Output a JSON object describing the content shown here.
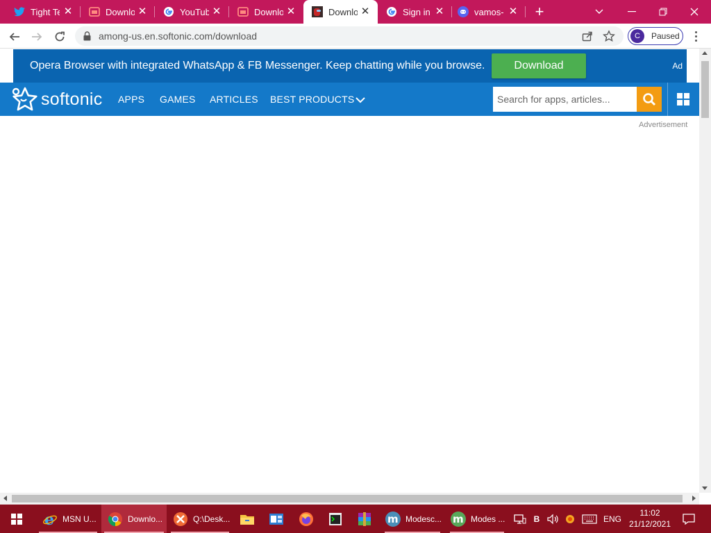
{
  "tabs": [
    {
      "title": "Tight Te",
      "icon": "twitter-icon",
      "active": false
    },
    {
      "title": "Downlo",
      "icon": "softonic-dl-icon",
      "active": false
    },
    {
      "title": "YouTub",
      "icon": "google-icon",
      "active": false
    },
    {
      "title": "Downlo",
      "icon": "softonic-dl-icon",
      "active": false
    },
    {
      "title": "Downlo",
      "icon": "among-us-icon",
      "active": true
    },
    {
      "title": "Sign in",
      "icon": "google-icon",
      "active": false
    },
    {
      "title": "vamos-",
      "icon": "discord-icon",
      "active": false
    }
  ],
  "tab_close_glyph": "✕",
  "new_tab_glyph": "+",
  "address": {
    "url": "among-us.en.softonic.com/download"
  },
  "profile": {
    "initial": "C",
    "status": "Paused"
  },
  "ad": {
    "message": "Opera Browser with integrated WhatsApp & FB Messenger. Keep chatting while you browse.",
    "button": "Download",
    "tag": "Ad"
  },
  "nav": {
    "brand": "softonic",
    "items": [
      "APPS",
      "GAMES",
      "ARTICLES",
      "BEST PRODUCTS"
    ],
    "search_placeholder": "Search for apps, articles..."
  },
  "advertisement_label": "Advertisement",
  "taskbar": {
    "apps": [
      {
        "label": "MSN U...",
        "icon": "internet-explorer-icon"
      },
      {
        "label": "Downlo...",
        "icon": "chrome-icon",
        "active": true
      },
      {
        "label": "Q:\\Desk...",
        "icon": "xampp-icon"
      },
      {
        "label": "",
        "icon": "file-explorer-icon"
      },
      {
        "label": "",
        "icon": "outlook-icon"
      },
      {
        "label": "",
        "icon": "firefox-icon"
      },
      {
        "label": "",
        "icon": "terminal-icon"
      },
      {
        "label": "",
        "icon": "winrar-icon"
      },
      {
        "label": "Modesc...",
        "icon": "modescore-icon"
      },
      {
        "label": "Modes ...",
        "icon": "modescore-green-icon"
      }
    ],
    "tray_lang": "ENG",
    "tray_b": "B",
    "time": "11:02",
    "date": "21/12/2021"
  },
  "colors": {
    "tabstrip": "#c2185b",
    "adbar": "#0a64b0",
    "navbar": "#1479c9",
    "download_button": "#4caf50",
    "search_button": "#f39c12",
    "taskbar": "#8a0f1e"
  }
}
